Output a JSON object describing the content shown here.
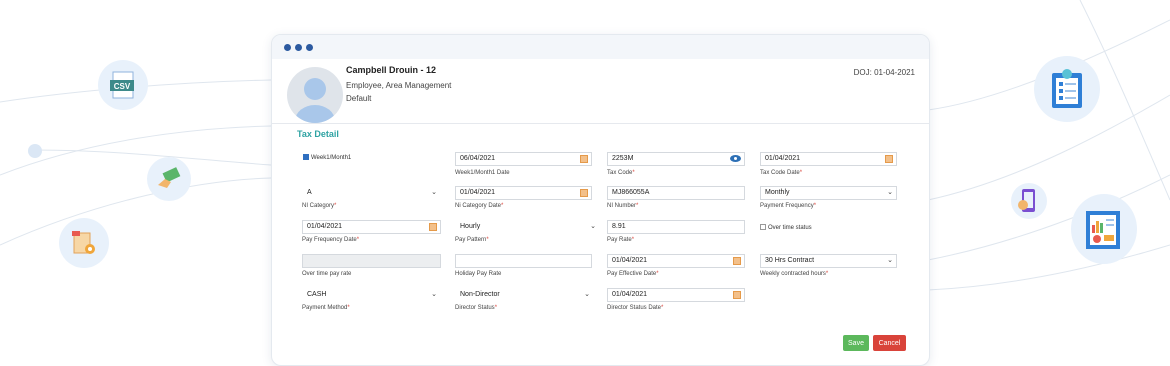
{
  "window": {
    "controls": [
      "dot-1",
      "dot-2",
      "dot-3"
    ]
  },
  "employee": {
    "name": "Campbell Drouin - 12",
    "role": "Employee, Area Management",
    "group": "Default",
    "doj": "DOJ: 01-04-2021"
  },
  "section_title": "Tax Detail",
  "fields": {
    "week1": {
      "label": "Week1/Month1",
      "checked": true
    },
    "week1_date": {
      "value": "06/04/2021",
      "label": "Week1/Month1 Date"
    },
    "tax_code": {
      "value": "2253M",
      "label": "Tax Code"
    },
    "tax_code_date": {
      "value": "01/04/2021",
      "label": "Tax Code Date"
    },
    "ni_category": {
      "value": "A",
      "label": "NI Category"
    },
    "ni_category_date": {
      "value": "01/04/2021",
      "label": "Ni Category Date"
    },
    "ni_number": {
      "value": "MJ866055A",
      "label": "NI Number"
    },
    "payment_frequency": {
      "value": "Monthly",
      "label": "Payment Frequency"
    },
    "pay_frequency_date": {
      "value": "01/04/2021",
      "label": "Pay Frequency Date"
    },
    "pay_pattern": {
      "value": "Hourly",
      "label": "Pay Pattern"
    },
    "pay_rate": {
      "value": "8.91",
      "label": "Pay Rate"
    },
    "overtime_status": {
      "label": "Over time status",
      "checked": false
    },
    "overtime_pay_rate": {
      "value": "",
      "label": "Over time pay rate"
    },
    "holiday_pay_rate": {
      "value": "",
      "label": "Holiday Pay Rate"
    },
    "pay_effective_date": {
      "value": "01/04/2021",
      "label": "Pay Effective Date"
    },
    "weekly_hours": {
      "value": "30 Hrs Contract",
      "label": "Weekly contracted hours"
    },
    "payment_method": {
      "value": "CASH",
      "label": "Payment Method"
    },
    "director_status": {
      "value": "Non-Director",
      "label": "Director Status"
    },
    "director_status_date": {
      "value": "01/04/2021",
      "label": "Director Status Date"
    }
  },
  "required_mark": "*",
  "buttons": {
    "save": "Save",
    "cancel": "Cancel"
  },
  "decor_icons": [
    "CSV",
    "cash-hand-icon",
    "settings-checklist-icon",
    "checklist-clipboard-icon",
    "phone-payment-icon",
    "report-charts-icon"
  ],
  "colors": {
    "accent": "#2fa3a3",
    "save": "#5cb85c",
    "cancel": "#d9433a",
    "nav_dot": "#2c5aa0"
  }
}
